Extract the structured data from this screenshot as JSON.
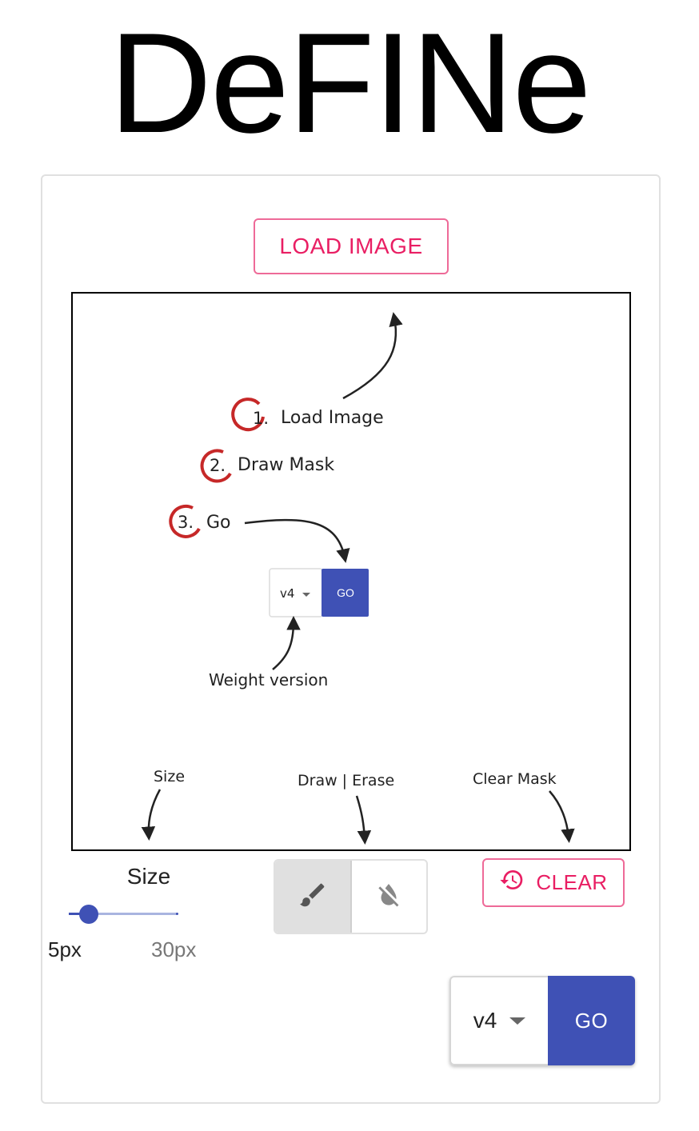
{
  "app": {
    "title": "DeFINe"
  },
  "toolbar": {
    "load_label": "LOAD IMAGE"
  },
  "instructions": {
    "step1": {
      "num": "1.",
      "text": "Load Image"
    },
    "step2": {
      "num": "2.",
      "text": "Draw Mask"
    },
    "step3": {
      "num": "3.",
      "text": "Go"
    },
    "mini_version": "v4",
    "mini_go": "GO",
    "weight_label": "Weight version",
    "size_hint": "Size",
    "draw_erase_hint": "Draw | Erase",
    "clear_hint": "Clear Mask"
  },
  "brush": {
    "label": "Size",
    "min_label": "5px",
    "max_label": "30px",
    "value_fraction": 0.04
  },
  "mode": {
    "draw_icon": "brush-icon",
    "erase_icon": "format-color-reset-icon",
    "selected": "draw"
  },
  "clear": {
    "label": "CLEAR",
    "icon": "history-icon"
  },
  "run": {
    "version": "v4",
    "go_label": "GO"
  },
  "colors": {
    "primary": "#3f51b5",
    "accent": "#e91e63",
    "marker_red": "#c62828"
  }
}
